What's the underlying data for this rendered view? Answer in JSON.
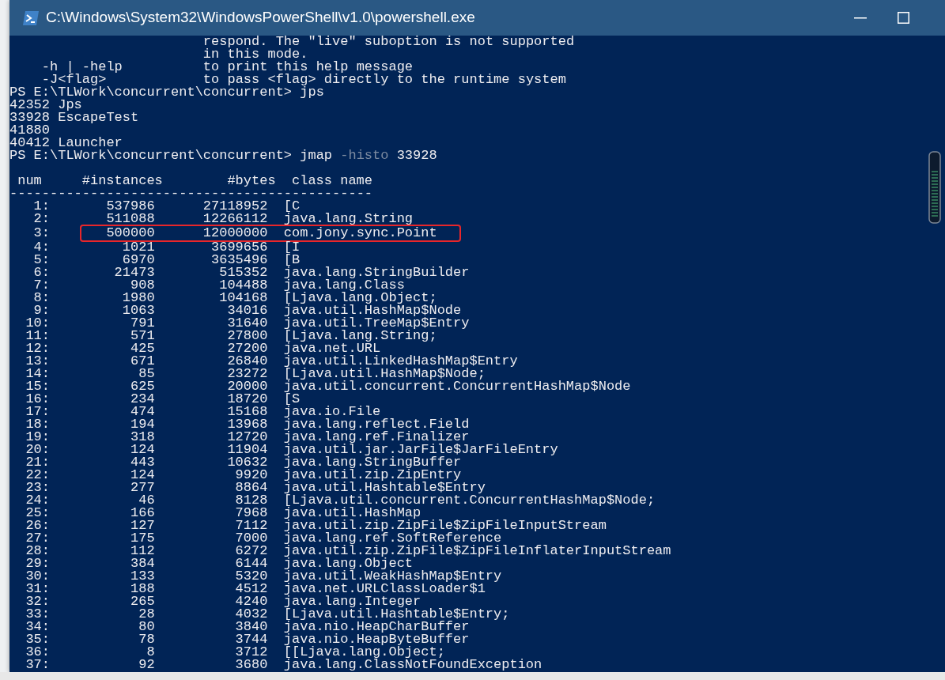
{
  "window": {
    "title": "C:\\Windows\\System32\\WindowsPowerShell\\v1.0\\powershell.exe"
  },
  "console": {
    "lines": [
      {
        "kind": "help",
        "description": "respond. The \"live\" suboption is not supported"
      },
      {
        "kind": "help",
        "description": "in this mode."
      },
      {
        "kind": "help",
        "option": "-h | -help",
        "description": "to print this help message"
      },
      {
        "kind": "help",
        "option": "-J<flag>",
        "description": "to pass <flag> directly to the runtime system"
      },
      {
        "kind": "prompt",
        "prompt": "PS E:\\TLWork\\concurrent\\concurrent>",
        "tokens": [
          {
            "kind": "command",
            "text": "jps"
          }
        ]
      },
      {
        "kind": "output",
        "text": "42352 Jps"
      },
      {
        "kind": "output",
        "text": "33928 EscapeTest"
      },
      {
        "kind": "output",
        "text": "41880"
      },
      {
        "kind": "output",
        "text": "40412 Launcher"
      },
      {
        "kind": "prompt",
        "prompt": "PS E:\\TLWork\\concurrent\\concurrent>",
        "tokens": [
          {
            "kind": "command",
            "text": "jmap"
          },
          {
            "kind": "parameter",
            "text": "-histo"
          },
          {
            "kind": "argument",
            "text": "33928"
          }
        ]
      },
      {
        "kind": "blank"
      }
    ]
  },
  "table": {
    "columns": [
      "num",
      "#instances",
      "#bytes",
      "class name"
    ],
    "rule": "---------------------------------------------",
    "rows": [
      {
        "num": "1:",
        "instances": "537986",
        "bytes": "27118952",
        "class_name": "[C",
        "highlighted": false
      },
      {
        "num": "2:",
        "instances": "511088",
        "bytes": "12266112",
        "class_name": "java.lang.String",
        "highlighted": false
      },
      {
        "num": "3:",
        "instances": "500000",
        "bytes": "12000000",
        "class_name": "com.jony.sync.Point",
        "highlighted": true
      },
      {
        "num": "4:",
        "instances": "1021",
        "bytes": "3699656",
        "class_name": "[I",
        "highlighted": false
      },
      {
        "num": "5:",
        "instances": "6970",
        "bytes": "3635496",
        "class_name": "[B",
        "highlighted": false
      },
      {
        "num": "6:",
        "instances": "21473",
        "bytes": "515352",
        "class_name": "java.lang.StringBuilder",
        "highlighted": false
      },
      {
        "num": "7:",
        "instances": "908",
        "bytes": "104488",
        "class_name": "java.lang.Class",
        "highlighted": false
      },
      {
        "num": "8:",
        "instances": "1980",
        "bytes": "104168",
        "class_name": "[Ljava.lang.Object;",
        "highlighted": false
      },
      {
        "num": "9:",
        "instances": "1063",
        "bytes": "34016",
        "class_name": "java.util.HashMap$Node",
        "highlighted": false
      },
      {
        "num": "10:",
        "instances": "791",
        "bytes": "31640",
        "class_name": "java.util.TreeMap$Entry",
        "highlighted": false
      },
      {
        "num": "11:",
        "instances": "571",
        "bytes": "27800",
        "class_name": "[Ljava.lang.String;",
        "highlighted": false
      },
      {
        "num": "12:",
        "instances": "425",
        "bytes": "27200",
        "class_name": "java.net.URL",
        "highlighted": false
      },
      {
        "num": "13:",
        "instances": "671",
        "bytes": "26840",
        "class_name": "java.util.LinkedHashMap$Entry",
        "highlighted": false
      },
      {
        "num": "14:",
        "instances": "85",
        "bytes": "23272",
        "class_name": "[Ljava.util.HashMap$Node;",
        "highlighted": false
      },
      {
        "num": "15:",
        "instances": "625",
        "bytes": "20000",
        "class_name": "java.util.concurrent.ConcurrentHashMap$Node",
        "highlighted": false
      },
      {
        "num": "16:",
        "instances": "234",
        "bytes": "18720",
        "class_name": "[S",
        "highlighted": false
      },
      {
        "num": "17:",
        "instances": "474",
        "bytes": "15168",
        "class_name": "java.io.File",
        "highlighted": false
      },
      {
        "num": "18:",
        "instances": "194",
        "bytes": "13968",
        "class_name": "java.lang.reflect.Field",
        "highlighted": false
      },
      {
        "num": "19:",
        "instances": "318",
        "bytes": "12720",
        "class_name": "java.lang.ref.Finalizer",
        "highlighted": false
      },
      {
        "num": "20:",
        "instances": "124",
        "bytes": "11904",
        "class_name": "java.util.jar.JarFile$JarFileEntry",
        "highlighted": false
      },
      {
        "num": "21:",
        "instances": "443",
        "bytes": "10632",
        "class_name": "java.lang.StringBuffer",
        "highlighted": false
      },
      {
        "num": "22:",
        "instances": "124",
        "bytes": "9920",
        "class_name": "java.util.zip.ZipEntry",
        "highlighted": false
      },
      {
        "num": "23:",
        "instances": "277",
        "bytes": "8864",
        "class_name": "java.util.Hashtable$Entry",
        "highlighted": false
      },
      {
        "num": "24:",
        "instances": "46",
        "bytes": "8128",
        "class_name": "[Ljava.util.concurrent.ConcurrentHashMap$Node;",
        "highlighted": false
      },
      {
        "num": "25:",
        "instances": "166",
        "bytes": "7968",
        "class_name": "java.util.HashMap",
        "highlighted": false
      },
      {
        "num": "26:",
        "instances": "127",
        "bytes": "7112",
        "class_name": "java.util.zip.ZipFile$ZipFileInputStream",
        "highlighted": false
      },
      {
        "num": "27:",
        "instances": "175",
        "bytes": "7000",
        "class_name": "java.lang.ref.SoftReference",
        "highlighted": false
      },
      {
        "num": "28:",
        "instances": "112",
        "bytes": "6272",
        "class_name": "java.util.zip.ZipFile$ZipFileInflaterInputStream",
        "highlighted": false
      },
      {
        "num": "29:",
        "instances": "384",
        "bytes": "6144",
        "class_name": "java.lang.Object",
        "highlighted": false
      },
      {
        "num": "30:",
        "instances": "133",
        "bytes": "5320",
        "class_name": "java.util.WeakHashMap$Entry",
        "highlighted": false
      },
      {
        "num": "31:",
        "instances": "188",
        "bytes": "4512",
        "class_name": "java.net.URLClassLoader$1",
        "highlighted": false
      },
      {
        "num": "32:",
        "instances": "265",
        "bytes": "4240",
        "class_name": "java.lang.Integer",
        "highlighted": false
      },
      {
        "num": "33:",
        "instances": "28",
        "bytes": "4032",
        "class_name": "[Ljava.util.Hashtable$Entry;",
        "highlighted": false
      },
      {
        "num": "34:",
        "instances": "80",
        "bytes": "3840",
        "class_name": "java.nio.HeapCharBuffer",
        "highlighted": false
      },
      {
        "num": "35:",
        "instances": "78",
        "bytes": "3744",
        "class_name": "java.nio.HeapByteBuffer",
        "highlighted": false
      },
      {
        "num": "36:",
        "instances": "8",
        "bytes": "3712",
        "class_name": "[[Ljava.lang.Object;",
        "highlighted": false
      },
      {
        "num": "37:",
        "instances": "92",
        "bytes": "3680",
        "class_name": "java.lang.ClassNotFoundException",
        "highlighted": false
      }
    ]
  }
}
